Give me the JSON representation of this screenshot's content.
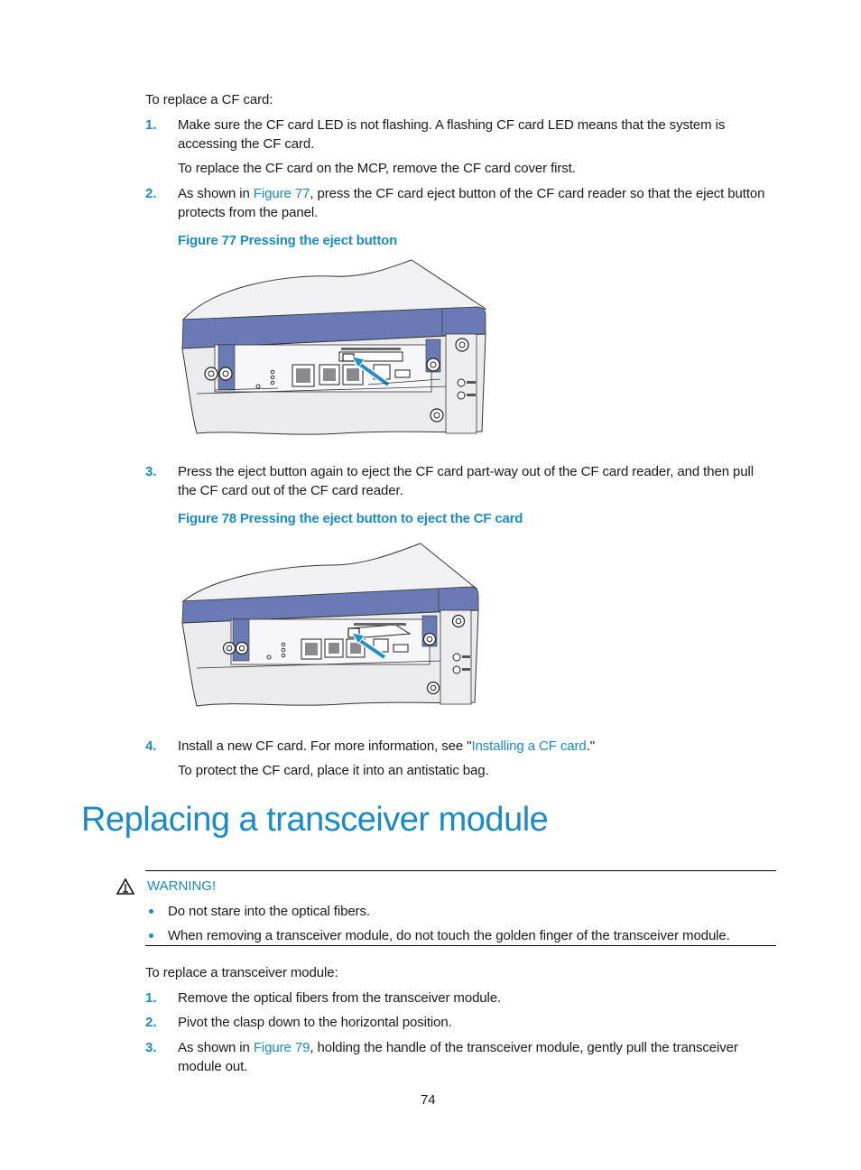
{
  "section1": {
    "intro": "To replace a CF card:",
    "steps": [
      {
        "num": "1.",
        "line1": "Make sure the CF card LED is not flashing. A flashing CF card LED means that the system is",
        "line2": "accessing the CF card.",
        "note": "To replace the CF card on the MCP, remove the CF card cover first."
      },
      {
        "num": "2.",
        "line1_before": "As shown in ",
        "line1_link": "Figure 77",
        "line1_after": ", press the CF card eject button of the CF card reader so that the eject button",
        "line2": "protects from the panel."
      },
      {
        "num": "3.",
        "line1": "Press the eject button again to eject the CF card part-way out of the CF card reader, and then pull",
        "line2": "the CF card out of the CF card reader."
      },
      {
        "num": "4.",
        "line1_before": "Install a new CF card. For more information, see \"",
        "line1_link": "Installing a CF card",
        "line1_after": ".\"",
        "note": "To protect the CF card, place it into an antistatic bag."
      }
    ],
    "figures": [
      {
        "caption": "Figure 77 Pressing the eject button",
        "alt": "Device front panel with arrow pointing to CF card eject button"
      },
      {
        "caption": "Figure 78 Pressing the eject button to eject the CF card",
        "alt": "Device front panel with arrow pointing to partially ejected CF card"
      }
    ]
  },
  "section2": {
    "heading": "Replacing a transceiver module",
    "warning": {
      "icon": "warning-triangle-icon",
      "label": "WARNING!",
      "bullets": [
        "Do not stare into the optical fibers.",
        "When removing a transceiver module, do not touch the golden finger of the transceiver module."
      ]
    },
    "intro": "To replace a transceiver module:",
    "steps": [
      {
        "num": "1.",
        "line1": "Remove the optical fibers from the transceiver module."
      },
      {
        "num": "2.",
        "line1": "Pivot the clasp down to the horizontal position."
      },
      {
        "num": "3.",
        "line1_before": "As shown in ",
        "line1_link": "Figure 79",
        "line1_after": ", holding the handle of the transceiver module, gently pull the transceiver",
        "line2": "module out."
      }
    ]
  },
  "footer": {
    "page_number": "74"
  },
  "colors": {
    "accent": "#1a8ac9",
    "chassis_blue": "#6a7ab5",
    "arrow_blue": "#1e90c8",
    "panel_gray": "#ececef"
  }
}
